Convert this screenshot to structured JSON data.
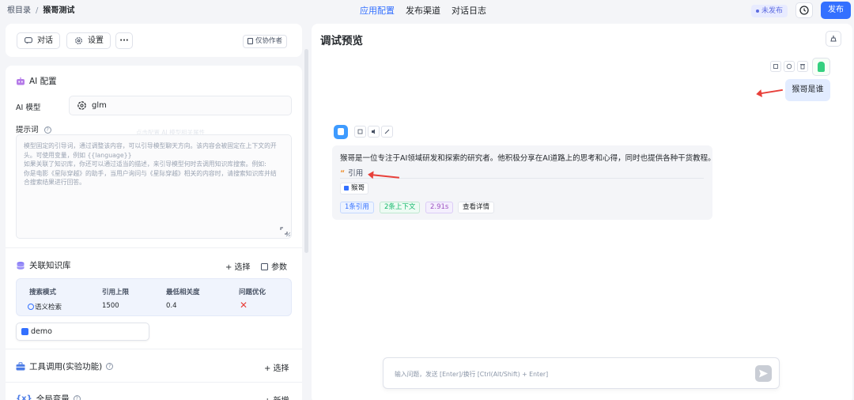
{
  "breadcrumb": {
    "root": "根目录",
    "separator": "/",
    "current": "猴哥测试"
  },
  "nav_tabs": [
    {
      "label": "应用配置",
      "active": true
    },
    {
      "label": "发布渠道",
      "active": false
    },
    {
      "label": "对话日志",
      "active": false
    }
  ],
  "header": {
    "status": "未发布",
    "publish_label": "发布"
  },
  "toolbar": {
    "chat_label": "对话",
    "settings_label": "设置",
    "more_label": "···",
    "collab_label": "仅协作者"
  },
  "ai_config": {
    "title": "AI 配置",
    "model_label": "AI 模型",
    "model_value": "glm",
    "prompt_label": "提示词",
    "prompt_ghost": "点击配置 AI 模型相关属性",
    "prompt_placeholder_lines": [
      "模型固定的引导词，通过调整该内容，可以引导模型聊天方向。该内容会被固定在上下文的开",
      "头。可使用变量，例如 {{language}}",
      "如果关联了知识库，你还可以通过适当的描述，来引导模型何时去调用知识库搜索。例如:",
      "你是电影《星际穿越》的助手，当用户询问与《星际穿越》相关的内容时，请搜索知识库并结",
      "合搜索结果进行回答。"
    ]
  },
  "knowledge": {
    "title": "关联知识库",
    "select_label": "+ 选择",
    "params_label": "参数",
    "columns": [
      "搜索模式",
      "引用上限",
      "最低相关度",
      "问题优化"
    ],
    "row": {
      "mode": "语义检索",
      "limit": "1500",
      "similarity": "0.4",
      "optimize": "✕"
    },
    "dataset": "demo"
  },
  "tools": {
    "title": "工具调用(实验功能)",
    "select_label": "+ 选择"
  },
  "variables": {
    "title": "全局变量",
    "add_label": "+ 新增"
  },
  "preview": {
    "title": "调试预览",
    "user_message": "猴哥是谁",
    "bot_message": "猴哥是一位专注于AI领域研发和探索的研究者。他积极分享在AI道路上的思考和心得，同时也提供各种干货教程。",
    "quote_label": "引用",
    "source": "猴哥",
    "tags": {
      "citations": "1条引用",
      "context": "2条上下文",
      "time": "2.91s",
      "details": "查看详情"
    },
    "input_placeholder": "输入问题，发送 [Enter]/换行 [Ctrl(Alt/Shift) + Enter]"
  },
  "colors": {
    "accent": "#3370ff",
    "arrow": "#e8403a",
    "cross": "#e8403a"
  }
}
